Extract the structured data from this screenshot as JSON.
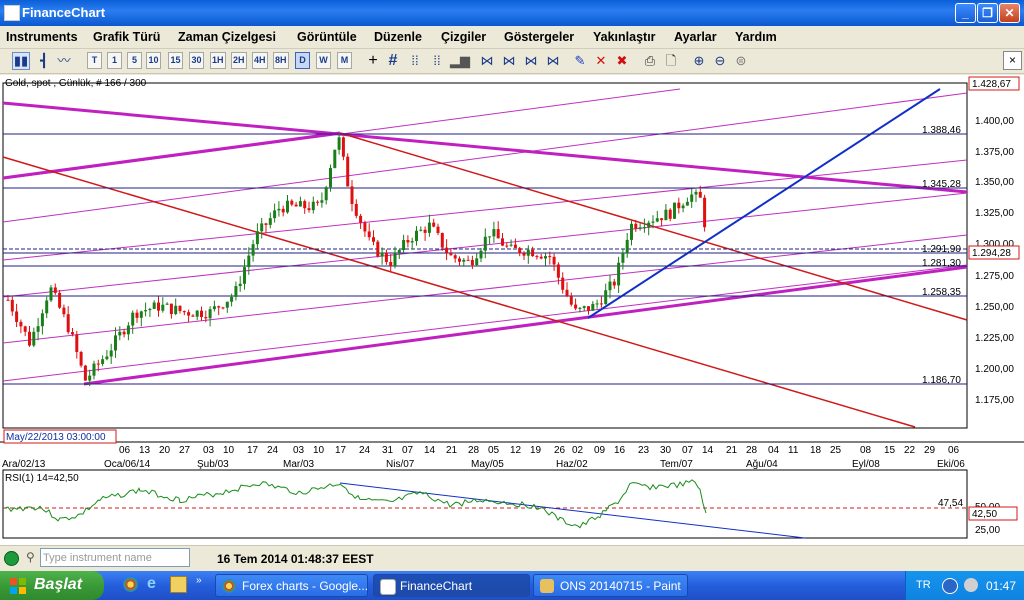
{
  "window": {
    "title": "FinanceChart",
    "controls": [
      "minimize",
      "maximize",
      "close"
    ]
  },
  "menu": [
    "Instruments",
    "Grafik Türü",
    "Zaman Çizelgesi",
    "Görüntüle",
    "Düzenle",
    "Çizgiler",
    "Göstergeler",
    "Yakınlaştır",
    "Ayarlar",
    "Yardım"
  ],
  "toolbar": {
    "timeframes": [
      "T",
      "1",
      "5",
      "10",
      "15",
      "30",
      "1H",
      "2H",
      "4H",
      "8H",
      "D",
      "W",
      "M"
    ],
    "selected_timeframe": "D",
    "icons": [
      "candlestick-chart-icon",
      "bar-chart-icon",
      "line-chart-icon",
      "crosshair-icon",
      "grid-icon",
      "scroll-left-icon",
      "scroll-right-icon",
      "volume-icon",
      "trendline-icons",
      "draw-pen-icon",
      "delete-line-icon",
      "delete-all-icon",
      "print-icon",
      "print-preview-icon",
      "zoom-in-icon",
      "zoom-out-icon",
      "zoom-reset-icon"
    ],
    "close_label": "×"
  },
  "chart": {
    "instrument_label": "Gold, spot , Günlük, # 166 / 300",
    "price_axis": [
      "1.400,00",
      "1.375,00",
      "1.350,00",
      "1.325,00",
      "1.300,00",
      "1.275,00",
      "1.250,00",
      "1.225,00",
      "1.200,00",
      "1.175,00"
    ],
    "top_price_tag": "1.428,67",
    "current_price_tag": "1.294,28",
    "hline_labels": [
      "1.388,46",
      "1.345,28",
      "1.291,90",
      "1.281,30",
      "1.258,35",
      "1.186,70"
    ],
    "cursor_date": "May/22/2013 03:00:00",
    "day_ticks": [
      "06",
      "13",
      "20",
      "27",
      "03",
      "10",
      "17",
      "24",
      "03",
      "10",
      "17",
      "24",
      "31",
      "07",
      "14",
      "21",
      "28",
      "05",
      "12",
      "19",
      "26",
      "02",
      "09",
      "16",
      "23",
      "30",
      "07",
      "14",
      "21",
      "28",
      "04",
      "11",
      "18",
      "25",
      "08",
      "15",
      "22",
      "29",
      "06"
    ],
    "month_labels": [
      "Ara/02/13",
      "Oca/06/14",
      "Şub/03",
      "Mar/03",
      "Nis/07",
      "May/05",
      "Haz/02",
      "Tem/07",
      "Ağu/04",
      "Eyl/08",
      "Eki/06"
    ],
    "colors": {
      "up_candle": "#1a7f1a",
      "down_candle": "#e01010",
      "magenta": "#c020c0",
      "red_channel": "#d01818",
      "blue_trend": "#1030c8",
      "hline": "#202080"
    }
  },
  "rsi": {
    "label": "RSI(1) 14=42,50",
    "axis": [
      "50,00",
      "25,00"
    ],
    "level_label": "47,54",
    "current_tag": "42,50",
    "color": "#1a8c1a"
  },
  "status": {
    "search_placeholder": "Type instrument name",
    "datetime": "16 Tem 2014 01:48:37 EEST"
  },
  "taskbar": {
    "start_label": "Başlat",
    "tasks": [
      "Forex charts - Google...",
      "FinanceChart",
      "ONS 20140715 - Paint"
    ],
    "language": "TR",
    "clock": "01:47"
  }
}
